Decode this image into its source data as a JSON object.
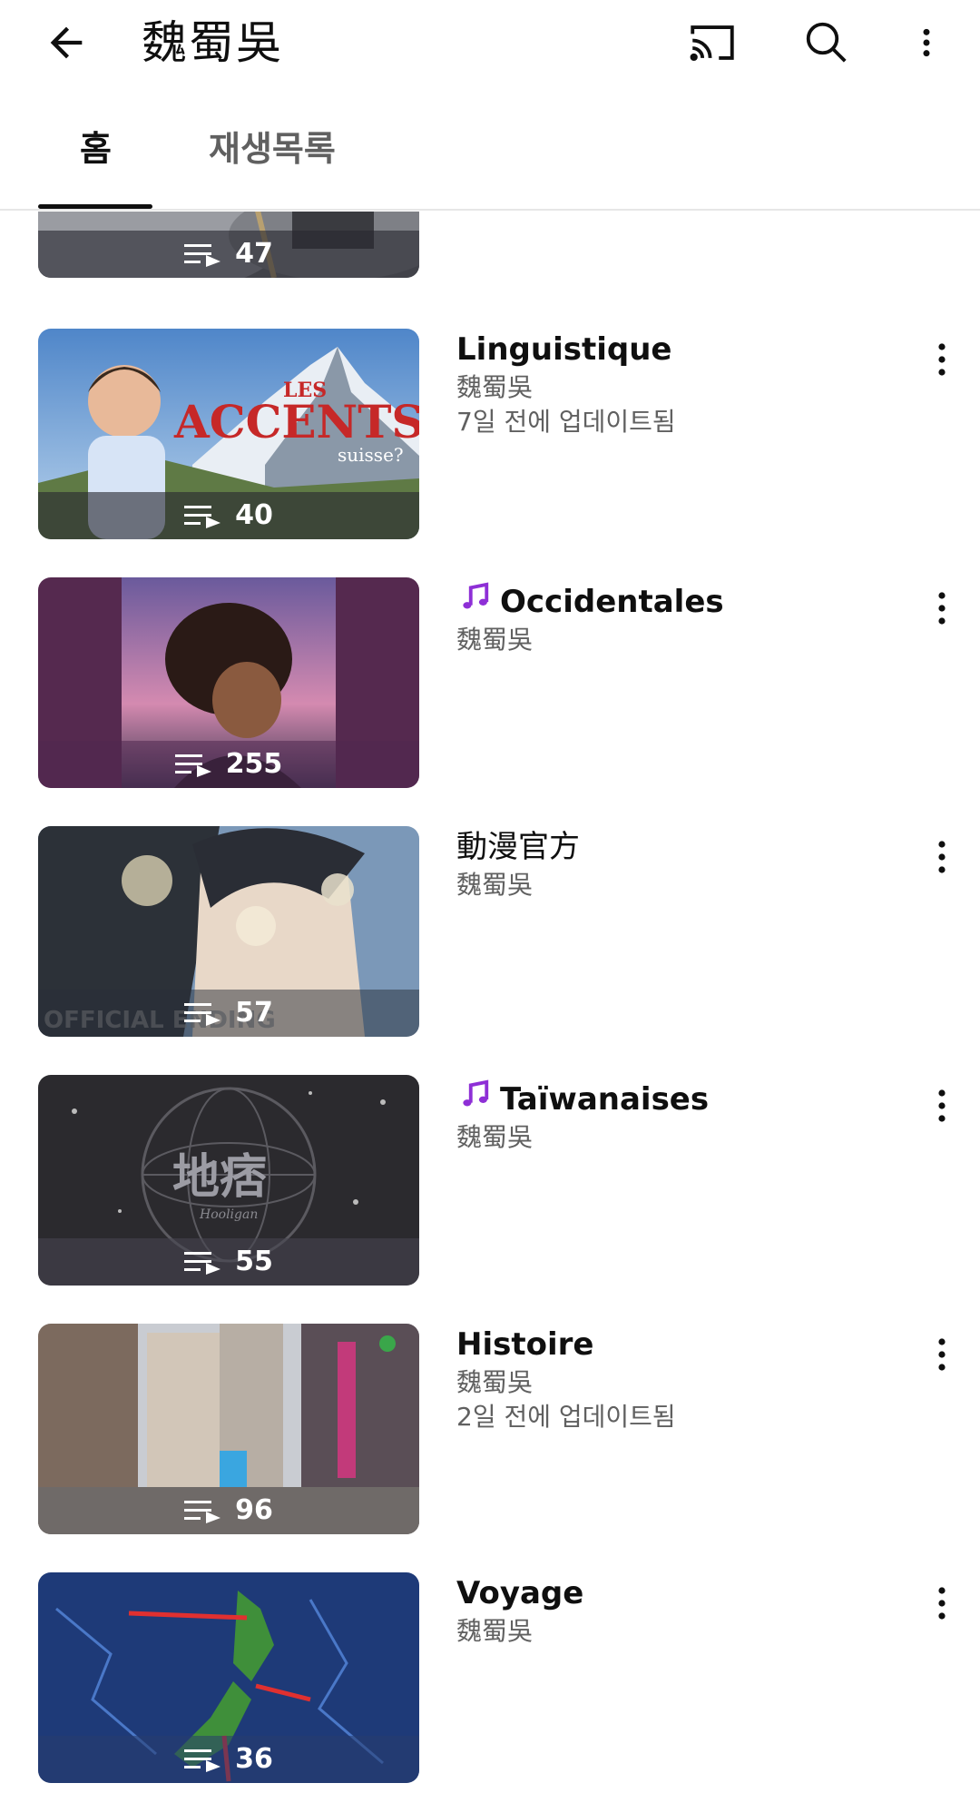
{
  "header": {
    "title": "魏蜀吳"
  },
  "tabs": [
    {
      "label": "홈",
      "selected": true
    },
    {
      "label": "재생목록",
      "selected": false
    }
  ],
  "playlists": [
    {
      "title": "",
      "owner": "",
      "updated": "",
      "count": "47",
      "music": false
    },
    {
      "title": "Linguistique",
      "owner": "魏蜀吳",
      "updated": "7일 전에 업데이트됨",
      "count": "40",
      "music": false,
      "thumb_text": {
        "les": "LES",
        "accents": "ACCENTS",
        "suisse": "suisse?"
      }
    },
    {
      "title": "Occidentales",
      "owner": "魏蜀吳",
      "updated": "",
      "count": "255",
      "music": true
    },
    {
      "title": "動漫官方",
      "owner": "魏蜀吳",
      "updated": "",
      "count": "57",
      "music": false,
      "thumb_text": {
        "caption": "OFFICIAL ENDING"
      }
    },
    {
      "title": "Taïwanaises",
      "owner": "魏蜀吳",
      "updated": "",
      "count": "55",
      "music": true,
      "thumb_text": {
        "logo": "地痞",
        "sub": "Hooligan"
      }
    },
    {
      "title": "Histoire",
      "owner": "魏蜀吳",
      "updated": "2일 전에 업데이트됨",
      "count": "96",
      "music": false
    },
    {
      "title": "Voyage",
      "owner": "魏蜀吳",
      "updated": "",
      "count": "36",
      "music": false
    }
  ],
  "icons": {
    "back": "arrow-left-icon",
    "cast": "cast-icon",
    "search": "search-icon",
    "more": "more-vert-icon",
    "playlist": "playlist-play-icon",
    "note": "music-note-icon"
  },
  "colors": {
    "text_primary": "#0f0f0f",
    "text_secondary": "#606060",
    "note_purple": "#8e2fd6"
  }
}
